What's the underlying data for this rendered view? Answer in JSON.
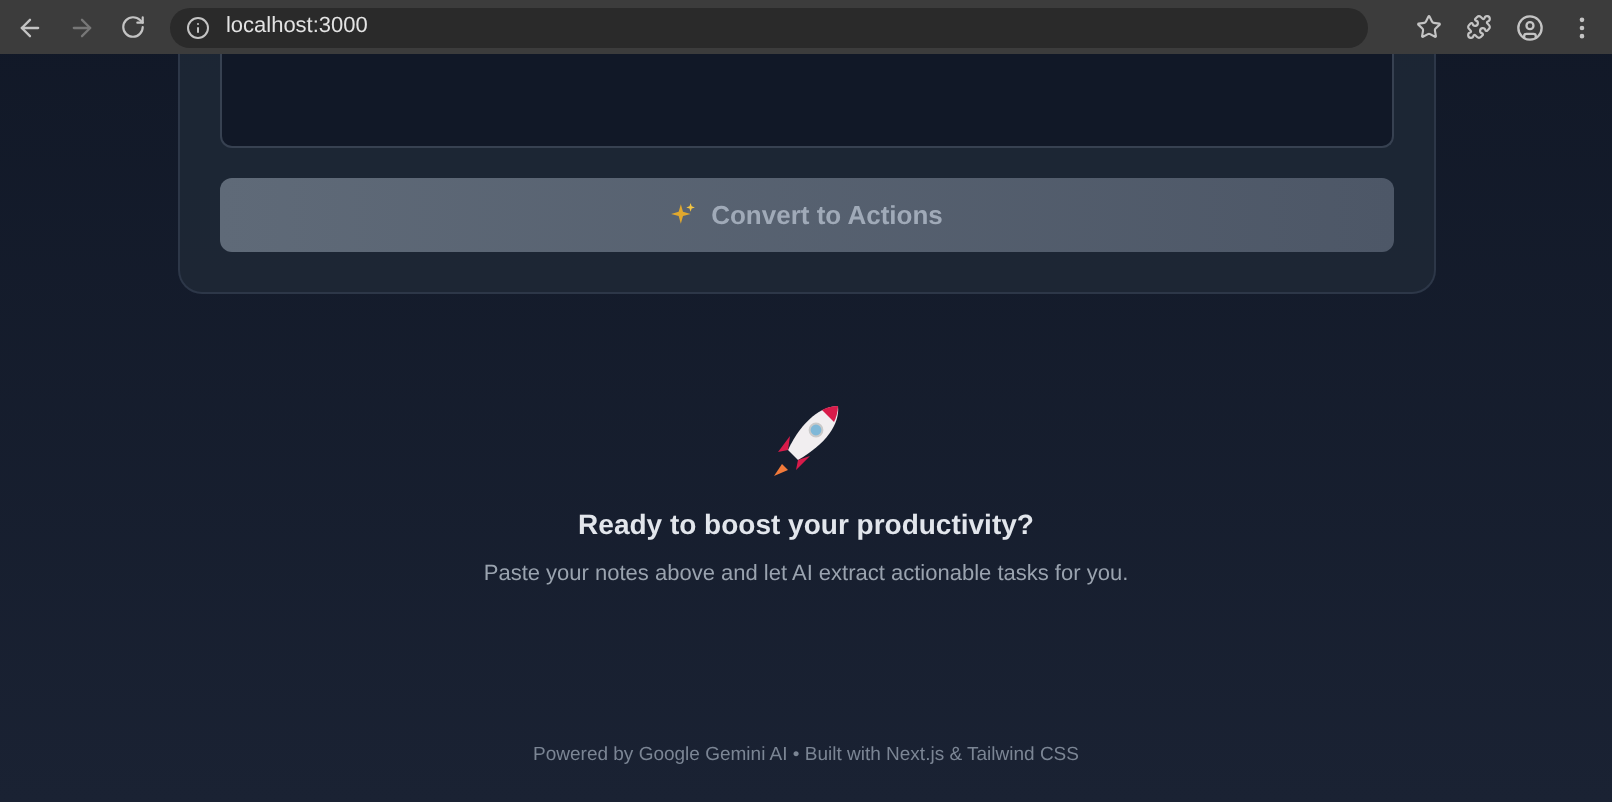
{
  "browser": {
    "address": "localhost:3000"
  },
  "convert_button": {
    "label": "Convert to Actions",
    "disabled": true
  },
  "empty_state": {
    "title": "Ready to boost your productivity?",
    "message": "Paste your notes above and let AI extract actionable tasks for you."
  },
  "footer": "Powered by Google Gemini AI • Built with Next.js & Tailwind CSS"
}
